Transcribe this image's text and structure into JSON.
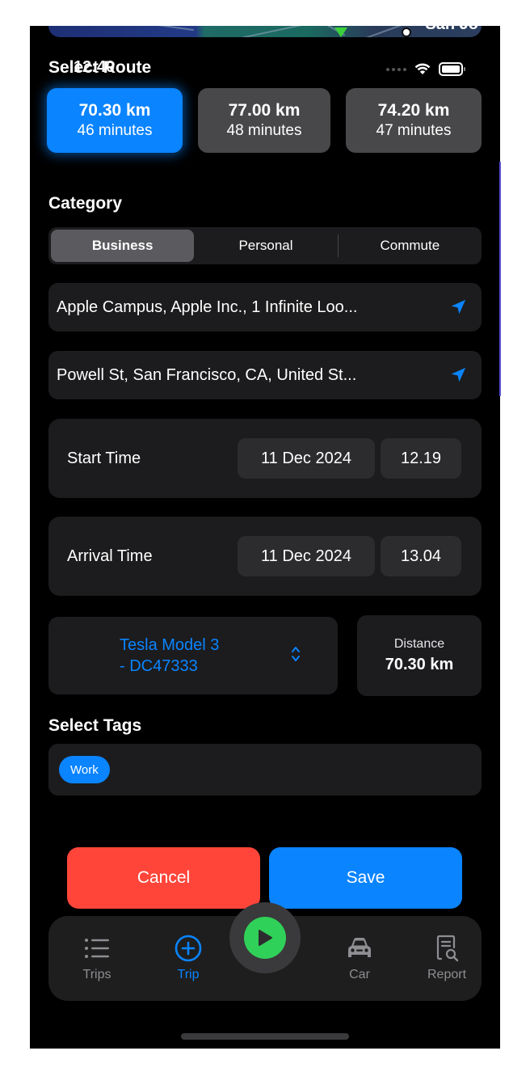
{
  "status_bar": {
    "time": "12:40"
  },
  "map": {
    "label_fragment": "San Jo"
  },
  "route_section": {
    "title": "Select Route",
    "routes": [
      {
        "distance": "70.30 km",
        "duration": "46 minutes",
        "selected": true
      },
      {
        "distance": "77.00 km",
        "duration": "48 minutes",
        "selected": false
      },
      {
        "distance": "74.20 km",
        "duration": "47 minutes",
        "selected": false
      }
    ]
  },
  "category": {
    "title": "Category",
    "options": [
      "Business",
      "Personal",
      "Commute"
    ],
    "selected": "Business"
  },
  "locations": {
    "start": "Apple Campus, Apple Inc., 1 Infinite Loo...",
    "end": "Powell St, San Francisco, CA, United St...",
    "icon": "location-arrow-icon"
  },
  "times": {
    "start": {
      "label": "Start Time",
      "date": "11 Dec 2024",
      "time": "12.19"
    },
    "arrival": {
      "label": "Arrival Time",
      "date": "11 Dec 2024",
      "time": "13.04"
    }
  },
  "vehicle": {
    "line1": "Tesla Model 3",
    "line2": "- DC47333"
  },
  "distance": {
    "label": "Distance",
    "value": "70.30 km"
  },
  "tags": {
    "title": "Select Tags",
    "items": [
      "Work"
    ]
  },
  "actions": {
    "cancel": "Cancel",
    "save": "Save"
  },
  "tabbar": {
    "items": [
      {
        "label": "Trips",
        "icon": "list-icon",
        "active": false
      },
      {
        "label": "Trip",
        "icon": "plus-circle-icon",
        "active": true
      },
      {
        "label": "Car",
        "icon": "car-icon",
        "active": false
      },
      {
        "label": "Report",
        "icon": "report-icon",
        "active": false
      }
    ],
    "center_button": "play-icon"
  },
  "colors": {
    "accent": "#0a84ff",
    "destructive": "#ff453a",
    "play": "#30d158",
    "surface": "#1c1c1e",
    "background": "#000000"
  }
}
